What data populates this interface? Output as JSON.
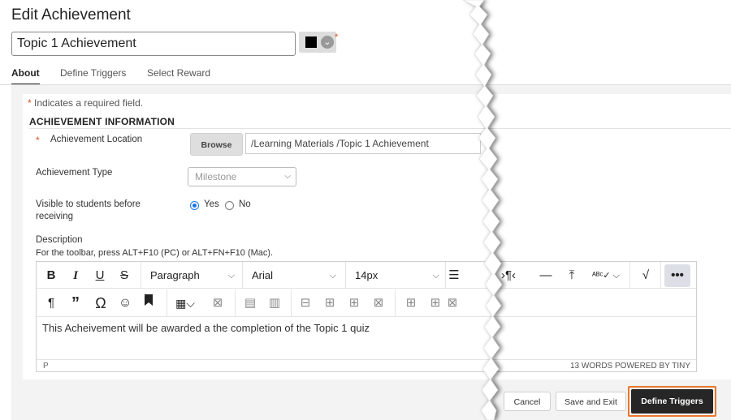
{
  "page_title": "Edit Achievement",
  "name_input": {
    "value": "Topic 1 Achievement"
  },
  "color_picker": {
    "color": "#000000"
  },
  "tabs": [
    {
      "label": "About"
    },
    {
      "label": "Define Triggers"
    },
    {
      "label": "Select Reward"
    }
  ],
  "required_note": {
    "star": "*",
    "text": "Indicates a required field."
  },
  "section_title": "ACHIEVEMENT INFORMATION",
  "location": {
    "star": "*",
    "label": "Achievement Location",
    "browse_label": "Browse",
    "value": "/Learning Materials /Topic 1 Achievement"
  },
  "type": {
    "label": "Achievement Type",
    "selected": "Milestone"
  },
  "visible": {
    "label": "Visible to students before receiving",
    "yes_label": "Yes",
    "no_label": "No"
  },
  "description": {
    "label": "Description",
    "toolbar_hint": "For the toolbar, press ALT+F10 (PC) or ALT+FN+F10 (Mac).",
    "block_format": "Paragraph",
    "font_family": "Arial",
    "font_size": "14px",
    "content": "This Acheivement will be awarded a the completion of the Topic 1 quiz",
    "status_path": "P",
    "status_words": "13 WORDS  POWERED BY TINY"
  },
  "footer": {
    "cancel_label": "Cancel",
    "save_exit_label": "Save and Exit",
    "define_triggers_label": "Define Triggers"
  },
  "colors": {
    "required": "#e04a1b",
    "primary_button": "#262626",
    "highlight": "#e8772e",
    "radio": "#1a73e8"
  },
  "icons": [
    "color-chevron-icon",
    "bold-icon",
    "italic-icon",
    "underline-icon",
    "strikethrough-icon",
    "align-icon",
    "paragraph-mark-icon",
    "horizontal-rule-icon",
    "insert-icon",
    "spellcheck-icon",
    "checkmark-icon",
    "more-icon",
    "pilcrow-icon",
    "quote-icon",
    "omega-icon",
    "emoji-icon",
    "bookmark-icon",
    "table-icon"
  ]
}
